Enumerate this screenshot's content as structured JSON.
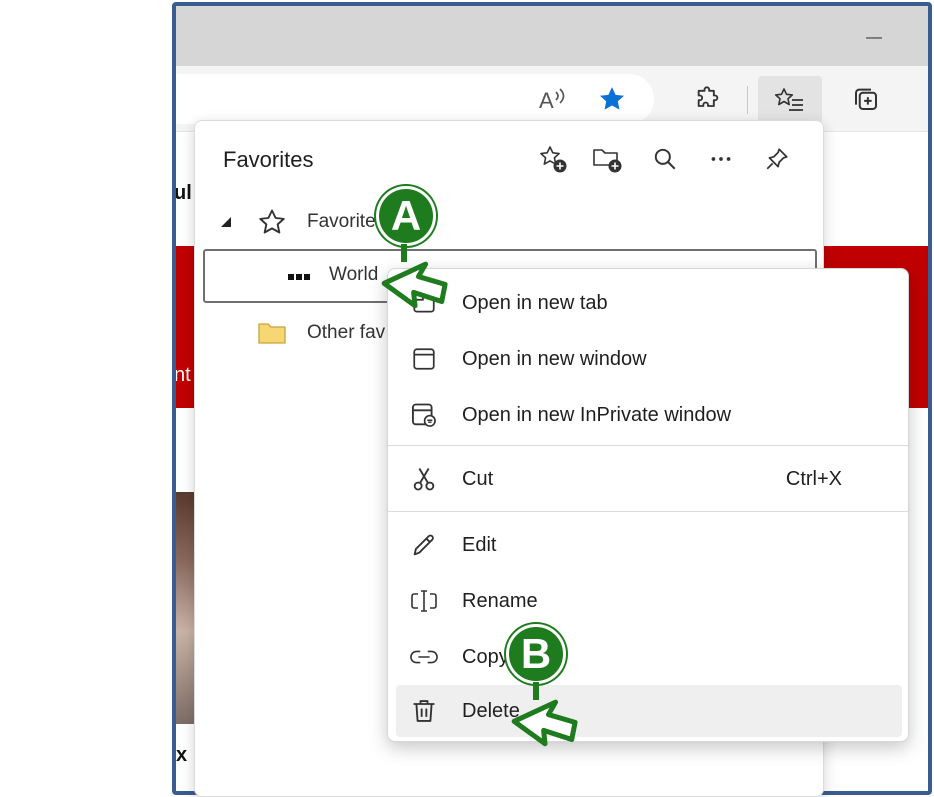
{
  "window": {
    "minimize_glyph": "—"
  },
  "toolbar": {
    "read_aloud_icon": "read-aloud-icon",
    "favorite_star_icon": "favorite-star-filled-icon",
    "extensions_icon": "extensions-icon",
    "favorites_icon": "favorites-icon",
    "collections_icon": "collections-icon"
  },
  "page": {
    "text_ul": "ul",
    "text_nt": "nt",
    "text_x": "x"
  },
  "favorites": {
    "title": "Favorites",
    "actions": [
      {
        "name": "add-favorite-icon"
      },
      {
        "name": "add-folder-icon"
      },
      {
        "name": "search-icon"
      },
      {
        "name": "more-icon"
      },
      {
        "name": "pin-icon"
      }
    ],
    "rows": [
      {
        "label": "Favorite",
        "icon": "star-outline-icon"
      },
      {
        "label": "World",
        "icon": "site-favicon-icon"
      },
      {
        "label": "Other fav",
        "icon": "folder-icon"
      }
    ]
  },
  "context_menu": {
    "items": [
      {
        "label": "Open in new tab",
        "icon": "new-tab-icon",
        "shortcut": ""
      },
      {
        "label": "Open in new window",
        "icon": "new-window-icon",
        "shortcut": ""
      },
      {
        "label": "Open in new InPrivate window",
        "icon": "inprivate-window-icon",
        "shortcut": ""
      },
      {
        "label": "Cut",
        "icon": "scissors-icon",
        "shortcut": "Ctrl+X"
      },
      {
        "label": "Edit",
        "icon": "pencil-icon",
        "shortcut": ""
      },
      {
        "label": "Rename",
        "icon": "rename-icon",
        "shortcut": ""
      },
      {
        "label": "Copy",
        "icon": "link-icon",
        "shortcut": ""
      },
      {
        "label": "Delete",
        "icon": "trash-icon",
        "shortcut": ""
      }
    ]
  },
  "callouts": {
    "a_label": "A",
    "b_label": "B",
    "color": "#1e7b1e"
  },
  "colors": {
    "accent_star": "#0a6fd6",
    "frame_border": "#3b5c8f",
    "page_red": "#c00000"
  }
}
